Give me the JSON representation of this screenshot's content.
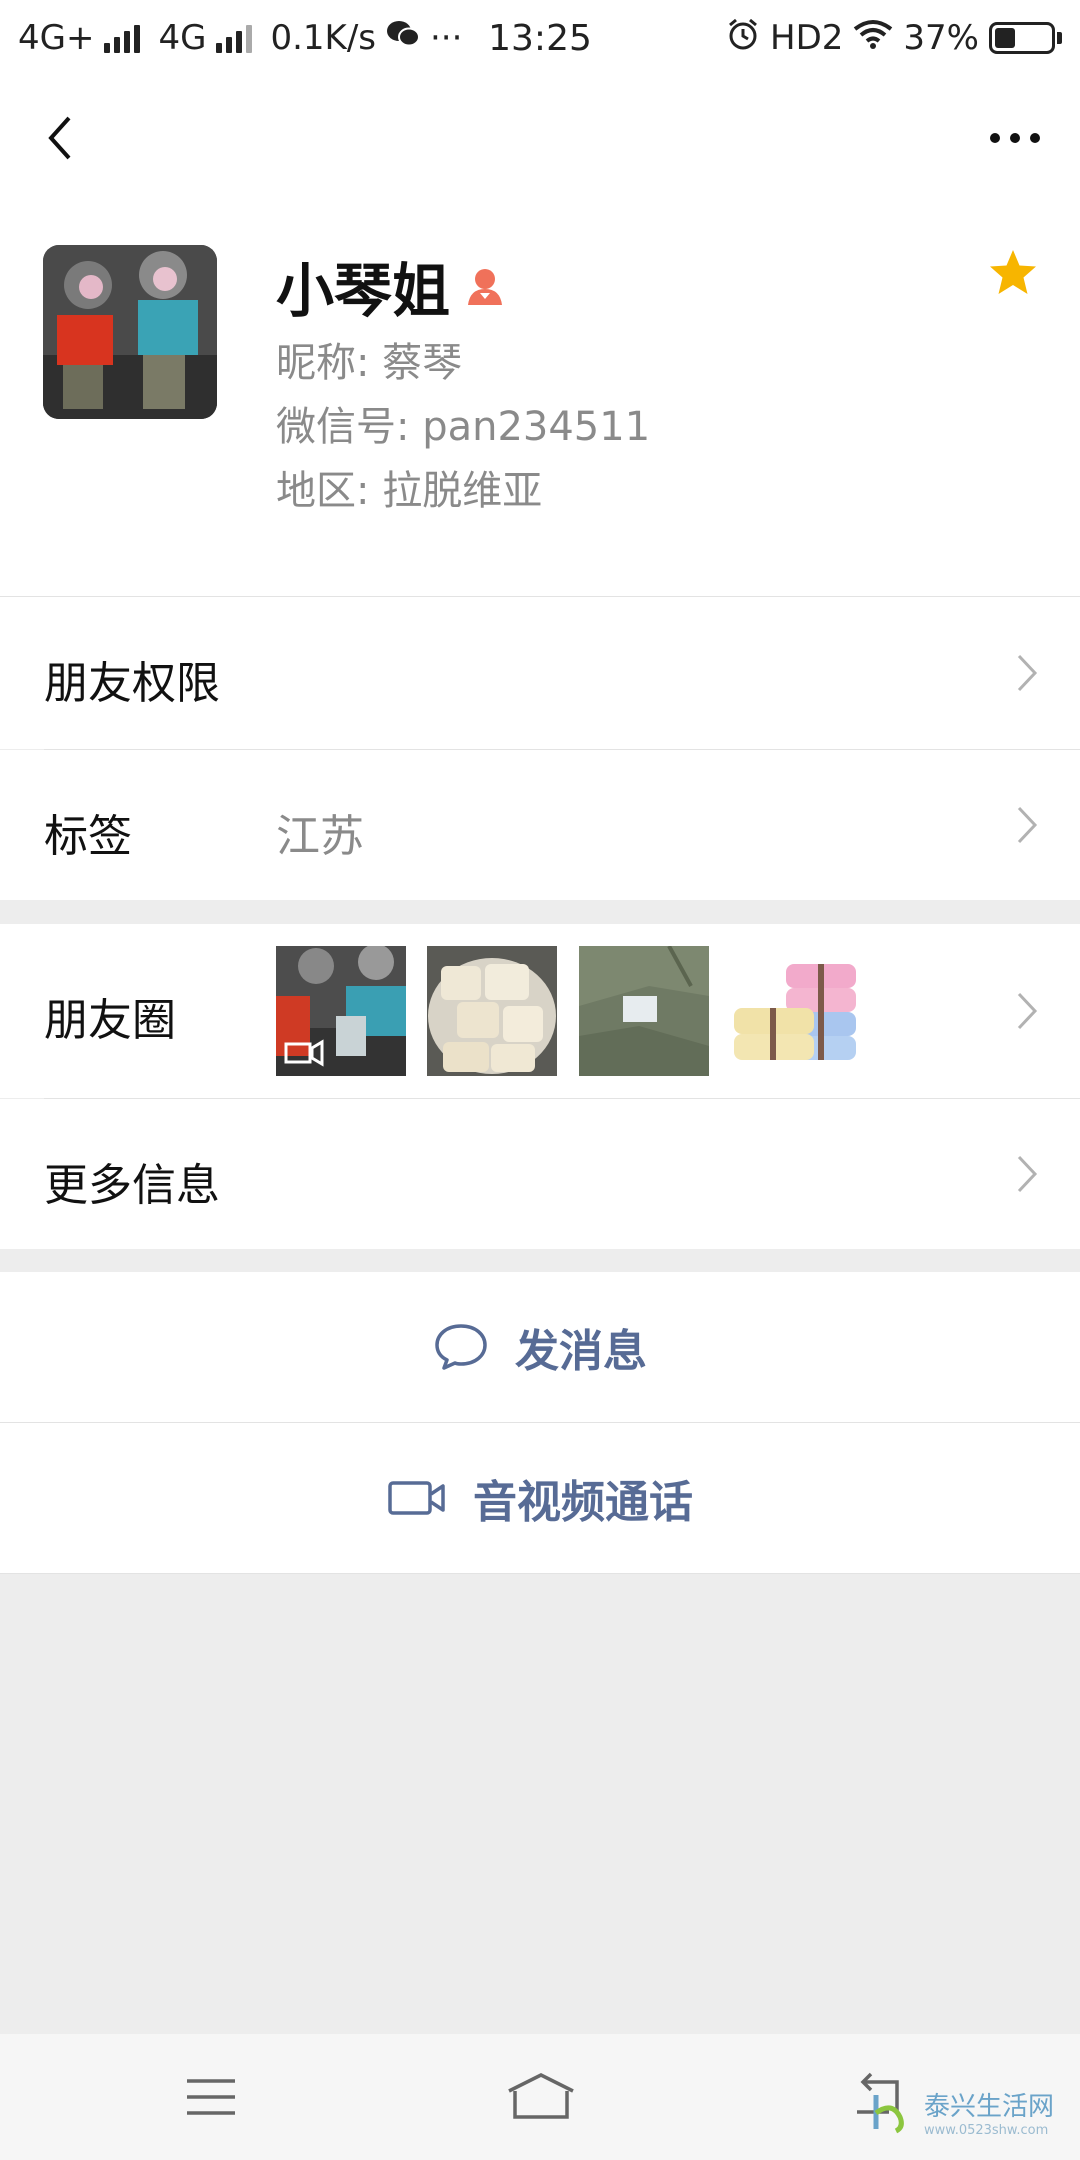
{
  "status_bar": {
    "network1": "4G+",
    "network2": "4G",
    "speed": "0.1K/s",
    "dots": "···",
    "time": "13:25",
    "hd": "HD2",
    "battery_percent": "37%",
    "battery_level": 0.37
  },
  "profile": {
    "name": "小琴姐",
    "nickname": "昵称:  蔡琴",
    "wechat_id": "微信号:  pan234511",
    "region": "地区:  拉脱维亚"
  },
  "rows": {
    "friend_permissions": "朋友权限",
    "tags_label": "标签",
    "tags_value": "江苏",
    "moments": "朋友圈",
    "more_info": "更多信息"
  },
  "actions": {
    "send_message": "发消息",
    "video_call": "音视频通话"
  },
  "watermark": {
    "title": "泰兴生活网",
    "url": "www.0523shw.com"
  },
  "colors": {
    "link": "#576b95",
    "star": "#f7b500",
    "female_badge": "#f0715a"
  }
}
